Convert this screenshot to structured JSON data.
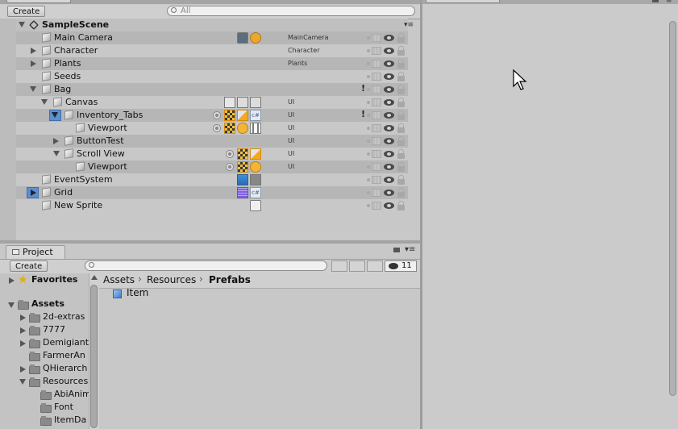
{
  "hierarchy": {
    "create_label": "Create",
    "search_placeholder": "All",
    "scene_name": "SampleScene",
    "rows": [
      {
        "name": "Main Camera",
        "tag": "MainCamera"
      },
      {
        "name": "Character",
        "tag": "Character"
      },
      {
        "name": "Plants",
        "tag": "Plants"
      },
      {
        "name": "Seeds",
        "tag": ""
      },
      {
        "name": "Bag",
        "tag": ""
      },
      {
        "name": "Canvas",
        "tag": "UI"
      },
      {
        "name": "Inventory_Tabs",
        "tag": "UI"
      },
      {
        "name": "Viewport",
        "tag": "UI"
      },
      {
        "name": "ButtonTest",
        "tag": "UI"
      },
      {
        "name": "Scroll View",
        "tag": "UI"
      },
      {
        "name": "Viewport",
        "tag": "UI"
      },
      {
        "name": "EventSystem",
        "tag": ""
      },
      {
        "name": "Grid",
        "tag": ""
      },
      {
        "name": "New Sprite",
        "tag": ""
      }
    ],
    "icons": [
      "unity-scene-icon",
      "camera-icon",
      "gear-icon",
      "cube-icon",
      "eye-icon",
      "lock-icon",
      "grid-toggle-icon",
      "csharp-script-icon",
      "image-component-icon",
      "event-system-icon",
      "tilemap-grid-icon",
      "sprite-renderer-icon",
      "scroll-rect-icon"
    ]
  },
  "project": {
    "tab_label": "Project",
    "create_label": "Create",
    "hidden_count": "11",
    "favorites_label": "Favorites",
    "assets_label": "Assets",
    "folders": [
      "2d-extras",
      "7777",
      "Demigiant",
      "FarmerAn",
      "QHierarch",
      "Resources",
      "AbiAnim",
      "Font",
      "ItemDa"
    ],
    "breadcrumb": [
      "Assets",
      "Resources",
      "Prefabs"
    ],
    "items": [
      "Item"
    ],
    "icons": [
      "folder-icon",
      "star-icon",
      "prefab-icon",
      "filter-type-icon",
      "label-icon",
      "favorite-icon",
      "hidden-eye-icon",
      "lock-icon",
      "menu-icon"
    ]
  },
  "inspector": {
    "icons": [
      "menu-icon",
      "lock-icon"
    ]
  },
  "colors": {
    "panel_bg": "#c8c8c8",
    "alt_row": "#b6b6b6",
    "accent_orange": "#f2a91e",
    "accent_blue": "#3d7cc9"
  }
}
